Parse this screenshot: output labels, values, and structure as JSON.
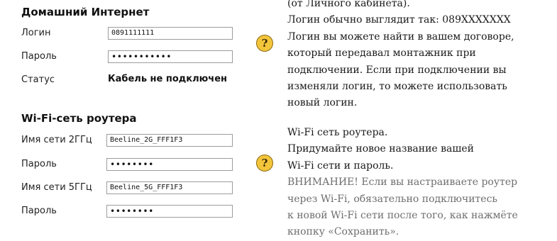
{
  "internet": {
    "title": "Домашний Интернет",
    "login_label": "Логин",
    "login_value": "0891111111",
    "password_label": "Пароль",
    "password_value": "•••••••••••",
    "status_label": "Статус",
    "status_value": "Кабель не подключен"
  },
  "wifi": {
    "title": "Wi-Fi-сеть роутера",
    "ssid24_label": "Имя сети 2ГГц",
    "ssid24_value": "Beeline_2G_FFF1F3",
    "password24_label": "Пароль",
    "password24_value": "••••••••",
    "ssid5_label": "Имя сети 5ГГц",
    "ssid5_value": "Beeline_5G_FFF1F3",
    "password5_label": "Пароль",
    "password5_value": "••••••••"
  },
  "help": {
    "icon": "?",
    "internet_lines": [
      "(от Личного кабинета).",
      "Логин обычно выглядит так: 089XXXXXXX",
      "Логин вы можете найти в вашем договоре,",
      "который передавал монтажник при",
      "подключении. Если при подключении вы",
      "изменяли логин, то можете использовать",
      "новый логин."
    ],
    "wifi_lines": [
      "Wi-Fi сеть роутера.",
      "Придумайте новое название вашей",
      "Wi-Fi сети и пароль."
    ],
    "wifi_warning_lines": [
      "ВНИМАНИЕ! Если вы настраиваете роутер",
      "через Wi-Fi, обязательно подключитесь",
      "к новой Wi-Fi сети после того, как нажмёте",
      "кнопку «Сохранить»."
    ]
  },
  "colors": {
    "help_icon": "#f3c53a",
    "warning_text": "#6e6e6e"
  }
}
